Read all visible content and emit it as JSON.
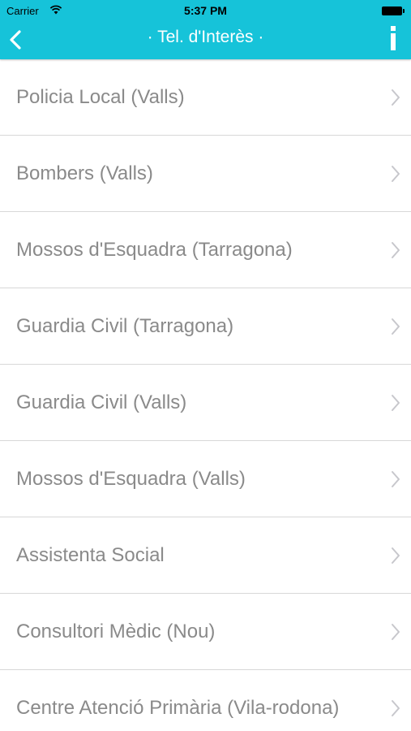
{
  "status_bar": {
    "carrier": "Carrier",
    "time": "5:37 PM"
  },
  "nav": {
    "title": "· Tel. d'Interès ·",
    "back_icon": "chevron-left-icon",
    "info_icon": "info-icon"
  },
  "colors": {
    "header": "#16c3d9",
    "text": "#8a8a8a",
    "divider": "#d8d8d8"
  },
  "list": {
    "items": [
      {
        "label": "Policia Local (Valls)"
      },
      {
        "label": "Bombers (Valls)"
      },
      {
        "label": "Mossos d'Esquadra (Tarragona)"
      },
      {
        "label": "Guardia Civil (Tarragona)"
      },
      {
        "label": "Guardia Civil (Valls)"
      },
      {
        "label": "Mossos d'Esquadra (Valls)"
      },
      {
        "label": "Assistenta Social"
      },
      {
        "label": "Consultori Mèdic (Nou)"
      },
      {
        "label": "Centre Atenció Primària (Vila-rodona)"
      }
    ]
  }
}
